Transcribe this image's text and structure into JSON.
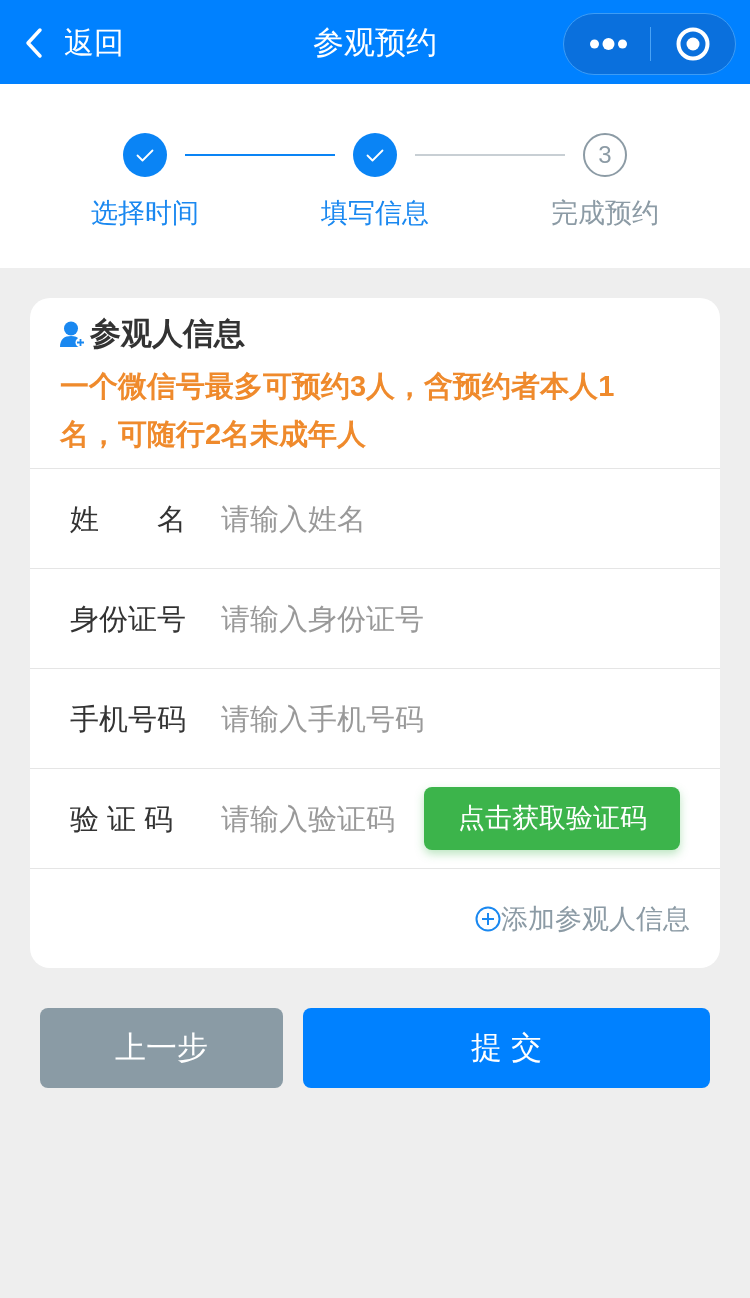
{
  "header": {
    "back": "返回",
    "title": "参观预约"
  },
  "steps": [
    {
      "label": "选择时间",
      "done": true
    },
    {
      "label": "填写信息",
      "done": true
    },
    {
      "label": "完成预约",
      "done": false,
      "number": "3"
    }
  ],
  "visitor_form": {
    "title": "参观人信息",
    "notice": "一个微信号最多可预约3人，含预约者本人1名，可随行2名未成年人",
    "fields": [
      {
        "kind": "text",
        "label": "姓　　名",
        "placeholder": "请输入姓名"
      },
      {
        "kind": "text",
        "label": "身份证号",
        "placeholder": "请输入身份证号"
      },
      {
        "kind": "text",
        "label": "手机号码",
        "placeholder": "请输入手机号码"
      },
      {
        "kind": "code",
        "label": "验 证 码",
        "placeholder": "请输入验证码",
        "button": "点击获取验证码"
      }
    ],
    "add_button": "添加参观人信息"
  },
  "actions": [
    {
      "kind": "secondary",
      "label": "上一步"
    },
    {
      "kind": "primary",
      "label": "提 交"
    }
  ]
}
